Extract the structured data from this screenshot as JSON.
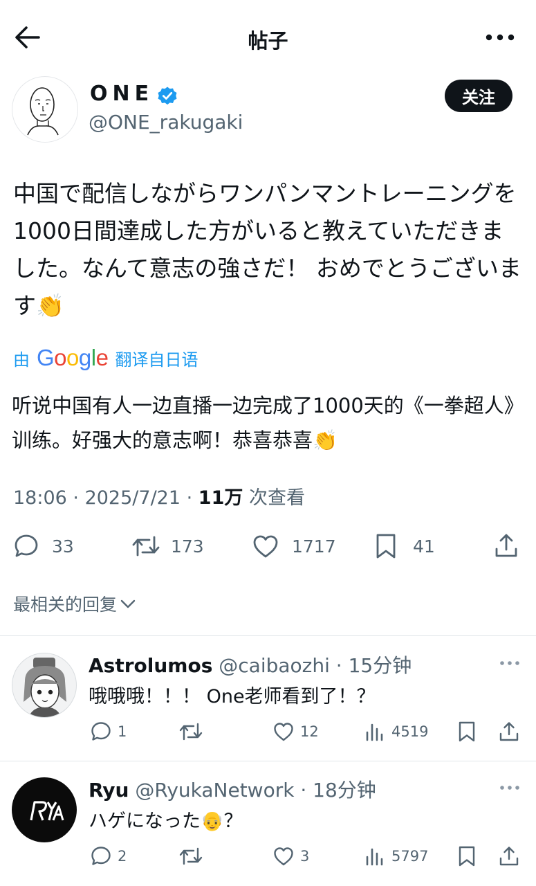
{
  "header": {
    "title": "帖子"
  },
  "author": {
    "name": "ONE",
    "handle": "@ONE_rakugaki",
    "follow_label": "关注"
  },
  "post": {
    "text": "中国で配信しながらワンパンマントレーニングを1000日間達成した方がいると教えていただきました。なんて意志の強さだ！ おめでとうございます👏",
    "translated_prefix": "由",
    "translated_logo": "Google",
    "translated_suffix": "翻译自日语",
    "translation": "听说中国有人一边直播一边完成了1000天的《一拳超人》训练。好强大的意志啊！恭喜恭喜👏",
    "time": "18:06",
    "date": "2025/7/21",
    "views_count": "11万",
    "views_label": "次查看"
  },
  "actions": {
    "replies": "33",
    "reposts": "173",
    "likes": "1717",
    "bookmarks": "41"
  },
  "sort_label": "最相关的回复",
  "replies": [
    {
      "name": "Astrolumos",
      "handle": "@caibaozhi",
      "time": "15分钟",
      "text": "哦哦哦！！！ One老师看到了！？",
      "reply_count": "1",
      "like_count": "12",
      "view_count": "4519"
    },
    {
      "name": "Ryu",
      "handle": "@RyukaNetwork",
      "time": "18分钟",
      "text": "ハゲになった👴？",
      "reply_count": "2",
      "like_count": "3",
      "view_count": "5797"
    }
  ],
  "icons": {
    "back": "arrow-left-icon",
    "more": "ellipsis-icon",
    "verified": "verified-badge-icon",
    "reply": "speech-bubble-icon",
    "repost": "repost-icon",
    "like": "heart-icon",
    "bookmark": "bookmark-icon",
    "share": "share-icon",
    "views": "bar-chart-icon",
    "chevron": "chevron-down-icon"
  },
  "colors": {
    "text": "#0f1419",
    "secondary": "#536471",
    "link": "#1d9bf0",
    "verified": "#1d9bf0",
    "follow_bg": "#0f1419"
  }
}
